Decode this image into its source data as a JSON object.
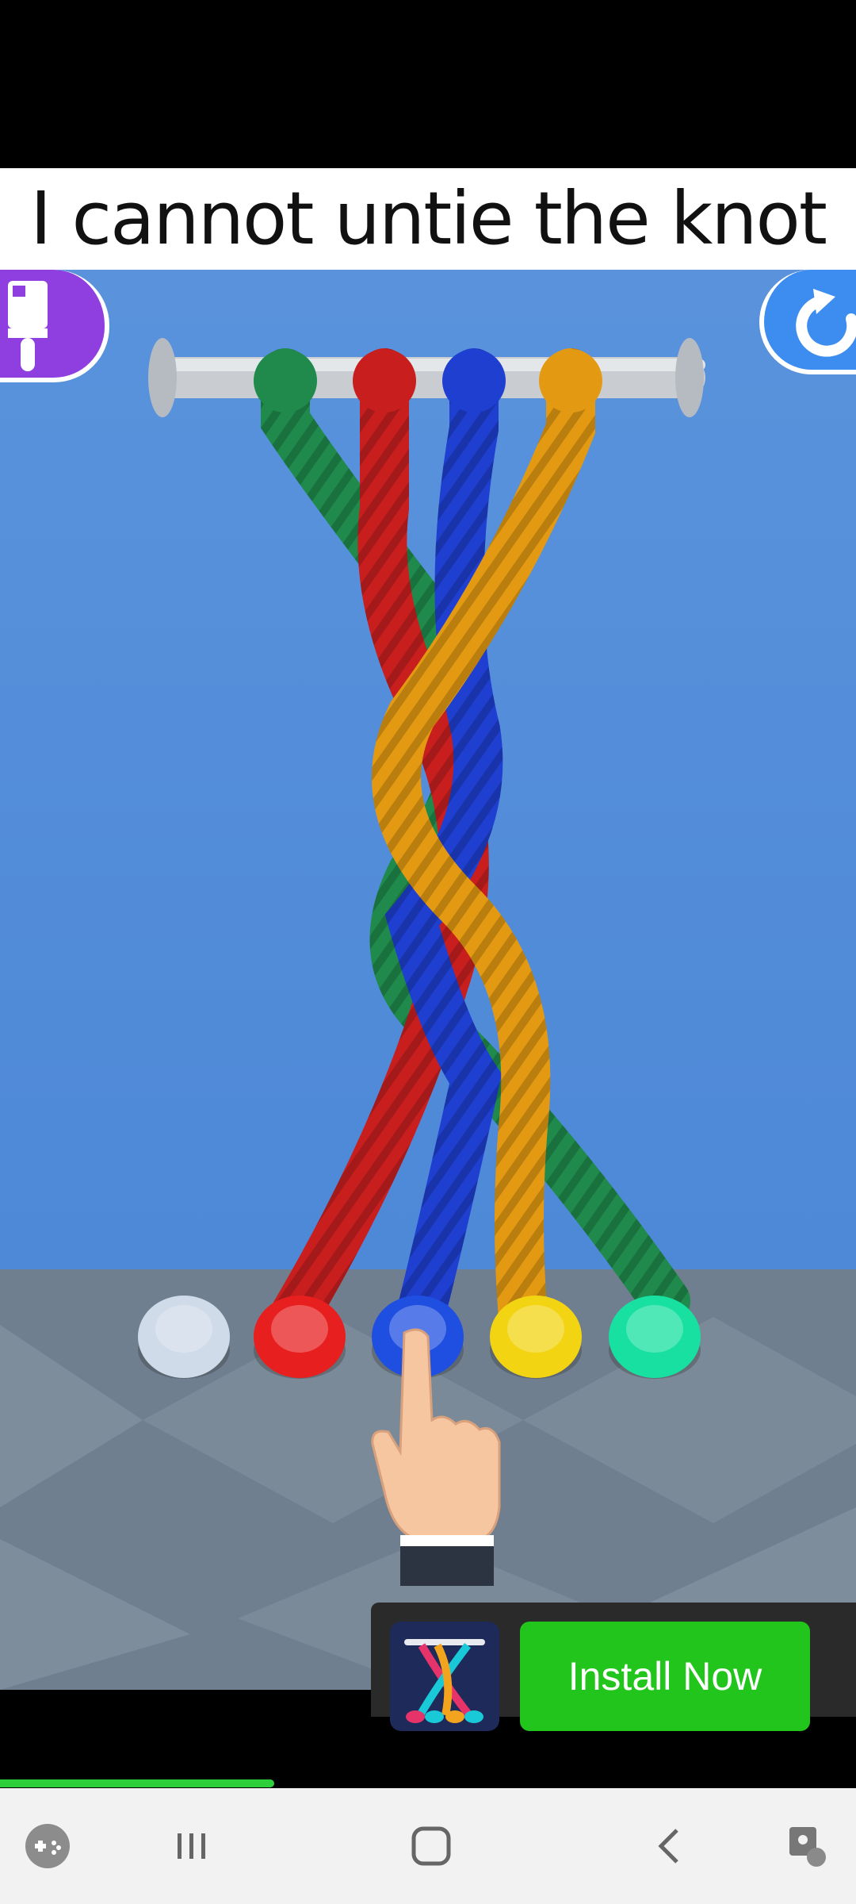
{
  "caption": "I cannot untie the knot",
  "buttons": {
    "paint_icon": "paintbrush-icon",
    "restart_icon": "restart-icon"
  },
  "game": {
    "rope_colors": [
      "#1f8a4c",
      "#c81e1e",
      "#1f3fd0",
      "#e39a12"
    ],
    "peg_colors": [
      "#cfdbe8",
      "#e81f1f",
      "#1f4fe0",
      "#f2d412",
      "#17e0a0"
    ],
    "hint_icon": "pointing-hand-icon"
  },
  "ad": {
    "install_label": "Install Now",
    "icon": "app-icon"
  },
  "progress": {
    "value": 0.32
  },
  "nav": {
    "items": [
      "game-launcher-icon",
      "recents-icon",
      "home-icon",
      "back-icon",
      "assistant-icon"
    ]
  },
  "colors": {
    "background_blue": "#5a93dc",
    "floor": "#6f7f8f",
    "install_green": "#22c51b",
    "progress_green": "#2fcf3c"
  }
}
